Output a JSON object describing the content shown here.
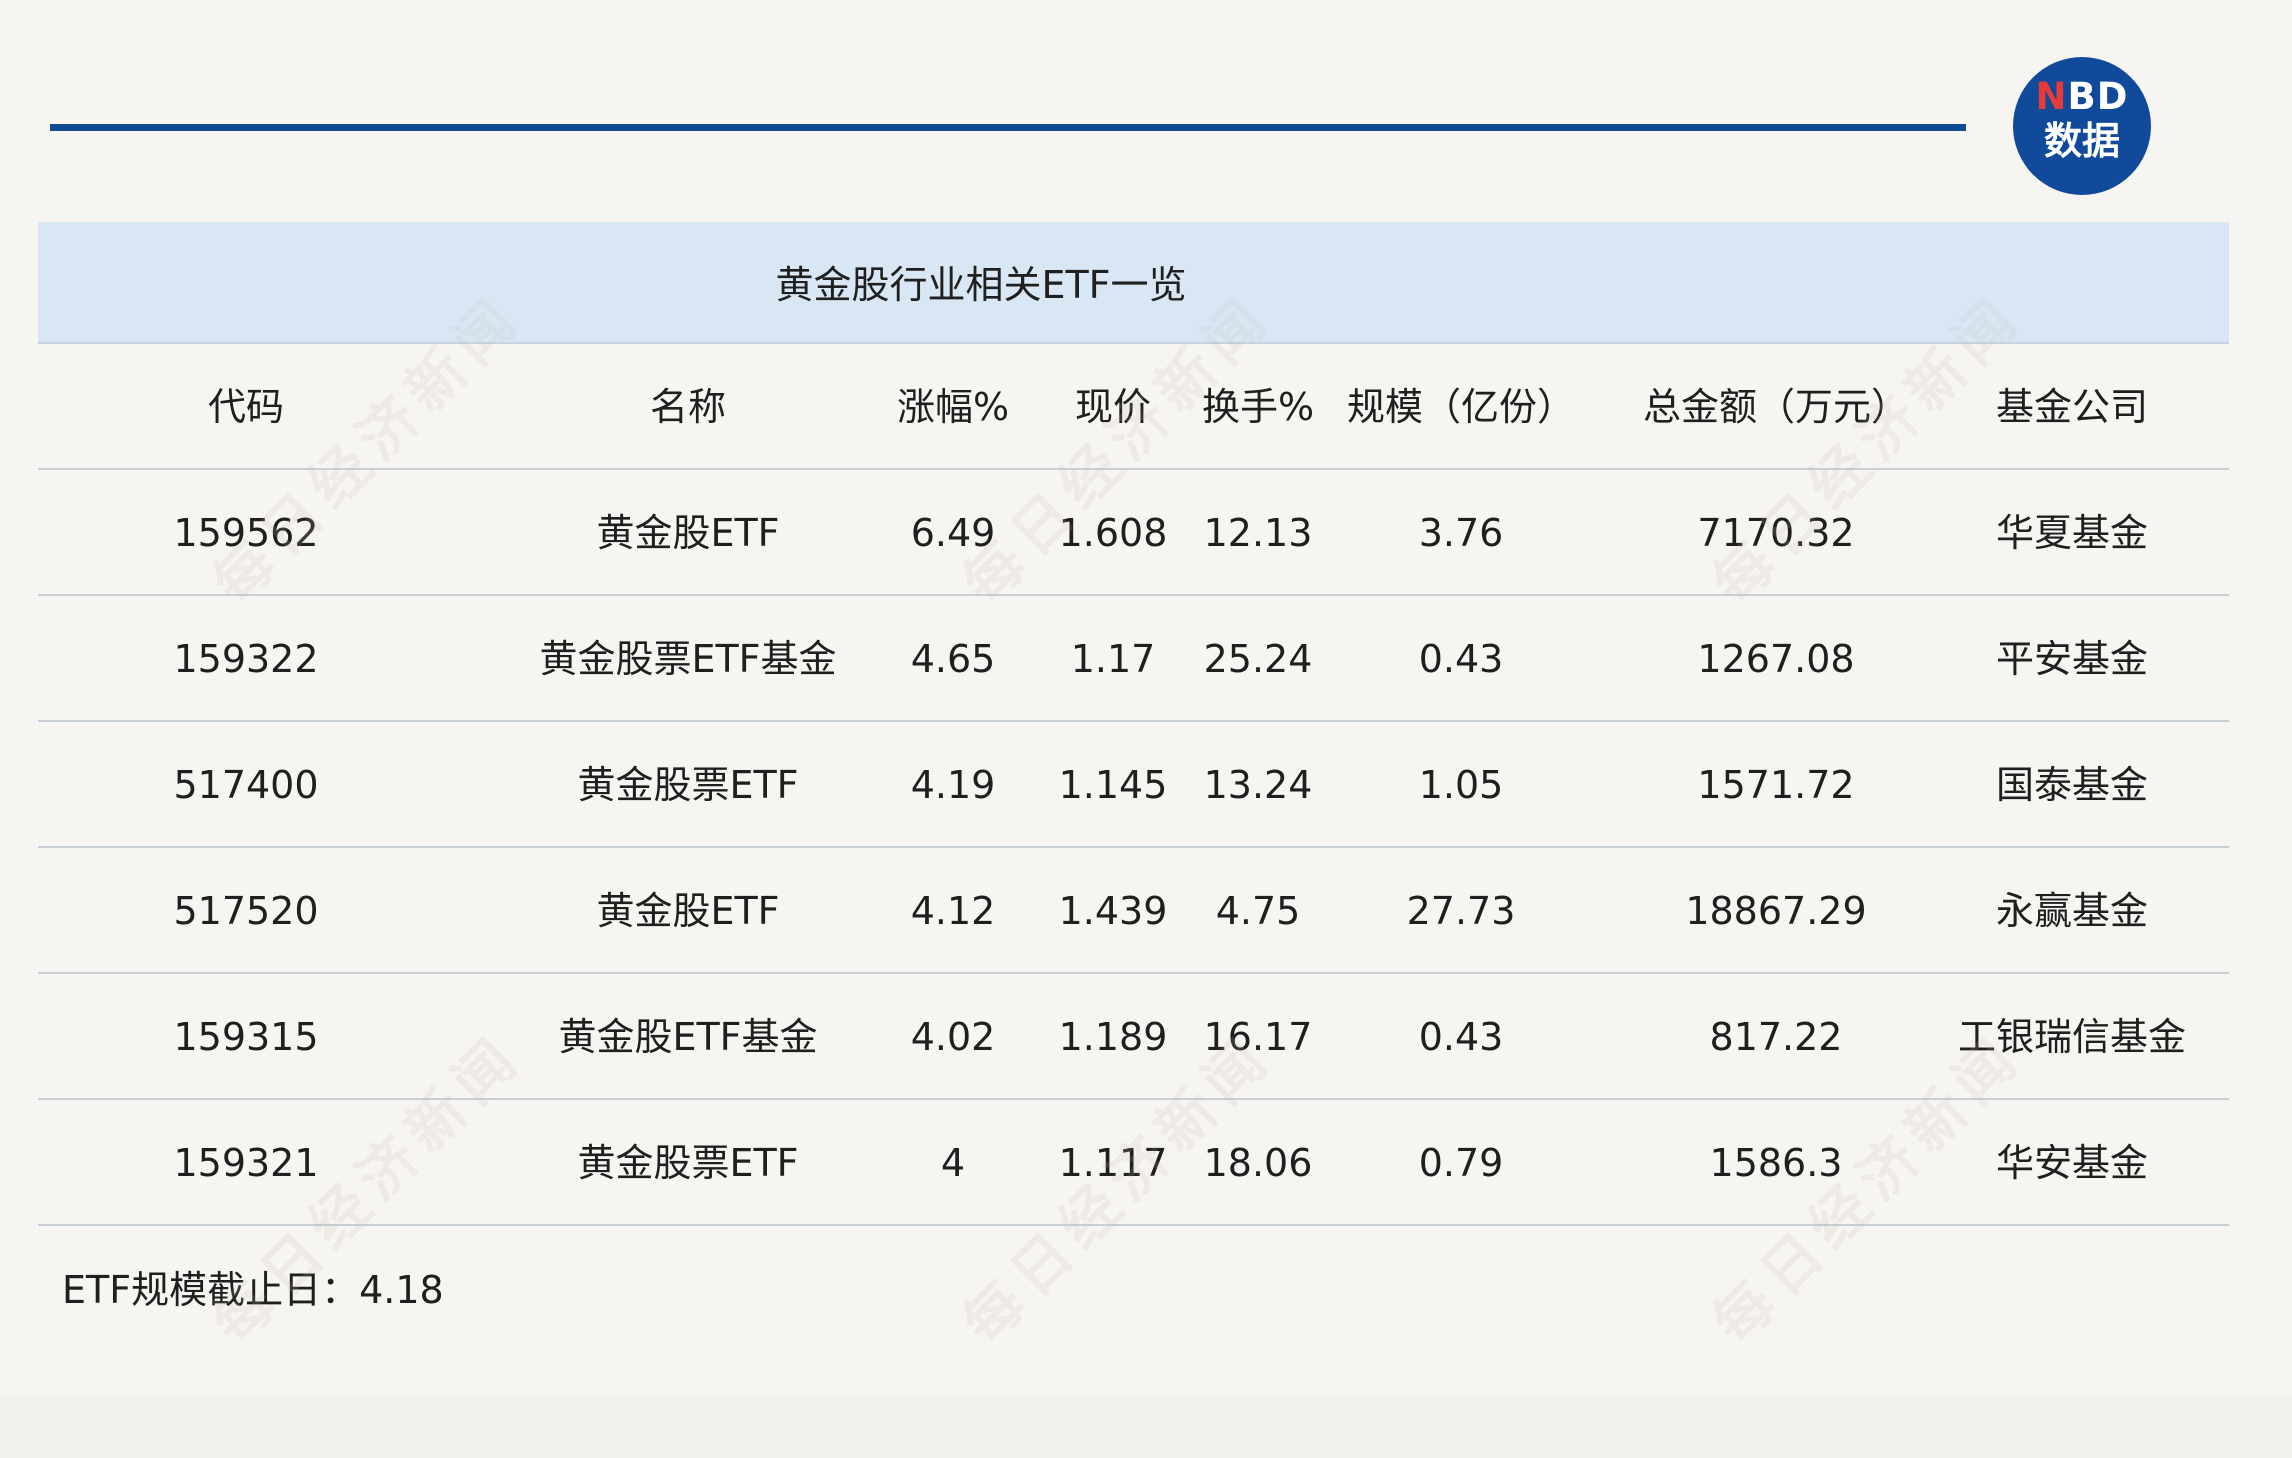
{
  "title": "黄金股行业相关ETF一览",
  "logo": {
    "top_n": "N",
    "top_bd": "BD",
    "bottom": "数据"
  },
  "headers": [
    "代码",
    "名称",
    "涨幅%",
    "现价",
    "换手%",
    "规模（亿份）",
    "总金额（万元）",
    "基金公司"
  ],
  "rows": [
    [
      "159562",
      "黄金股ETF",
      "6.49",
      "1.608",
      "12.13",
      "3.76",
      "7170.32",
      "华夏基金"
    ],
    [
      "159322",
      "黄金股票ETF基金",
      "4.65",
      "1.17",
      "25.24",
      "0.43",
      "1267.08",
      "平安基金"
    ],
    [
      "517400",
      "黄金股票ETF",
      "4.19",
      "1.145",
      "13.24",
      "1.05",
      "1571.72",
      "国泰基金"
    ],
    [
      "517520",
      "黄金股ETF",
      "4.12",
      "1.439",
      "4.75",
      "27.73",
      "18867.29",
      "永赢基金"
    ],
    [
      "159315",
      "黄金股ETF基金",
      "4.02",
      "1.189",
      "16.17",
      "0.43",
      "817.22",
      "工银瑞信基金"
    ],
    [
      "159321",
      "黄金股票ETF",
      "4",
      "1.117",
      "18.06",
      "0.79",
      "1586.3",
      "华安基金"
    ]
  ],
  "footnote": "ETF规模截止日：4.18",
  "watermark": "每日经济新闻",
  "colors": {
    "accent": "#0f4a95",
    "title_bg": "#d9e7f5",
    "page_bg": "#f7f5f1"
  }
}
